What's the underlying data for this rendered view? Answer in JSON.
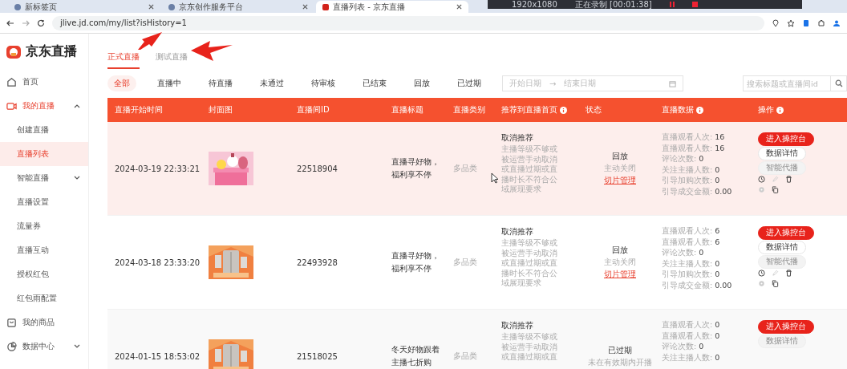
{
  "browser": {
    "tabs": [
      {
        "title": "新标签页",
        "selected": false
      },
      {
        "title": "京东创作服务平台",
        "selected": false
      },
      {
        "title": "直播列表 - 京东直播",
        "selected": true
      }
    ],
    "url": "jlive.jd.com/my/list?isHistory=1"
  },
  "recorder": {
    "resolution": "1920x1080",
    "status": "正在录制 [00:01:38]"
  },
  "logo": "京东直播",
  "sidebar": {
    "items": [
      {
        "label": "首页",
        "selected": false
      },
      {
        "label": "我的直播",
        "selected": true,
        "expanded": true,
        "children": [
          {
            "label": "创建直播",
            "selected": false
          },
          {
            "label": "直播列表",
            "selected": true
          },
          {
            "label": "智能直播",
            "selected": false,
            "expanded": false
          },
          {
            "label": "直播设置",
            "selected": false
          },
          {
            "label": "流量券",
            "selected": false
          },
          {
            "label": "直播互动",
            "selected": false
          },
          {
            "label": "授权红包",
            "selected": false
          },
          {
            "label": "红包雨配置",
            "selected": false
          }
        ]
      },
      {
        "label": "我的商品",
        "selected": false
      },
      {
        "label": "数据中心",
        "selected": false,
        "expanded": false
      }
    ]
  },
  "tabs": [
    {
      "label": "正式直播",
      "selected": true
    },
    {
      "label": "测试直播",
      "selected": false
    }
  ],
  "filters": [
    {
      "label": "全部",
      "selected": true
    },
    {
      "label": "直播中",
      "selected": false
    },
    {
      "label": "待直播",
      "selected": false
    },
    {
      "label": "未通过",
      "selected": false
    },
    {
      "label": "待审核",
      "selected": false
    },
    {
      "label": "已结束",
      "selected": false
    },
    {
      "label": "回放",
      "selected": false
    },
    {
      "label": "已过期",
      "selected": false
    }
  ],
  "date_range": {
    "start_placeholder": "开始日期",
    "separator": "→",
    "end_placeholder": "结束日期"
  },
  "search": {
    "placeholder": "搜索标题或直播间id"
  },
  "table": {
    "columns": [
      {
        "label": "直播开始时间",
        "info": false
      },
      {
        "label": "封面图",
        "info": false
      },
      {
        "label": "直播间ID",
        "info": false
      },
      {
        "label": "直播标题",
        "info": false
      },
      {
        "label": "直播类别",
        "info": false
      },
      {
        "label": "推荐到直播首页",
        "info": true
      },
      {
        "label": "状态",
        "info": false
      },
      {
        "label": "直播数据",
        "info": true
      },
      {
        "label": "操作",
        "info": true
      }
    ],
    "rows": [
      {
        "hovered": true,
        "start_time": "2024-03-19 22:33:21",
        "id": "22518904",
        "title": "直播寻好物，福利享不停",
        "category": "多品类",
        "recommend": {
          "action": "取消推荐",
          "reason": "主播等级不够或被运营手动取消或直播过期或直播时长不符合公域展现要求"
        },
        "status": {
          "kind": "playback",
          "label": "回放",
          "note": "主动关闭",
          "link": "切片管理"
        },
        "stats": [
          {
            "label": "直播观看人次:",
            "value": "16"
          },
          {
            "label": "直播观看人数:",
            "value": "16"
          },
          {
            "label": "评论次数:",
            "value": "0"
          },
          {
            "label": "关注主播人数:",
            "value": "0"
          },
          {
            "label": "引导加购次数:",
            "value": "0"
          },
          {
            "label": "引导成交金额:",
            "value": "0.00"
          }
        ],
        "actions": [
          {
            "label": "进入操控台",
            "kind": "primary",
            "disabled": false
          },
          {
            "label": "数据详情",
            "kind": "plain",
            "disabled": false
          },
          {
            "label": "智能代播",
            "kind": "plain",
            "disabled": true
          }
        ],
        "tools": [
          {
            "disabled": false
          },
          {
            "disabled": true
          },
          {
            "disabled": false
          },
          {
            "disabled": true
          },
          {
            "disabled": false
          }
        ]
      },
      {
        "hovered": false,
        "start_time": "2024-03-18 23:33:20",
        "id": "22493928",
        "title": "直播寻好物，福利享不停",
        "category": "多品类",
        "recommend": {
          "action": "取消推荐",
          "reason": "主播等级不够或被运营手动取消或直播过期或直播时长不符合公域展现要求"
        },
        "status": {
          "kind": "playback",
          "label": "回放",
          "note": "主动关闭",
          "link": "切片管理"
        },
        "stats": [
          {
            "label": "直播观看人次:",
            "value": "6"
          },
          {
            "label": "直播观看人数:",
            "value": "6"
          },
          {
            "label": "评论次数:",
            "value": "0"
          },
          {
            "label": "关注主播人数:",
            "value": "0"
          },
          {
            "label": "引导加购次数:",
            "value": "0"
          },
          {
            "label": "引导成交金额:",
            "value": "0.00"
          }
        ],
        "actions": [
          {
            "label": "进入操控台",
            "kind": "primary",
            "disabled": false
          },
          {
            "label": "数据详情",
            "kind": "plain",
            "disabled": false
          },
          {
            "label": "智能代播",
            "kind": "plain",
            "disabled": true
          }
        ],
        "tools": [
          {
            "disabled": false
          },
          {
            "disabled": true
          },
          {
            "disabled": false
          },
          {
            "disabled": true
          },
          {
            "disabled": false
          }
        ]
      },
      {
        "hovered": false,
        "start_time": "2024-01-15 18:53:02",
        "id": "21518025",
        "title": "冬天好物跟着主播七折购",
        "category": "多品类",
        "recommend": {
          "action": "取消推荐",
          "reason": "主播等级不够或被运营手动取消或直播过期或直"
        },
        "status": {
          "kind": "expired",
          "label": "已过期",
          "note": "未在有效期内开播"
        },
        "stats": [
          {
            "label": "直播观看人次:",
            "value": "0"
          },
          {
            "label": "直播观看人数:",
            "value": "0"
          },
          {
            "label": "评论次数:",
            "value": "0"
          },
          {
            "label": "关注主播人数:",
            "value": "0"
          }
        ],
        "actions": [
          {
            "label": "进入操控台",
            "kind": "primary",
            "disabled": false
          },
          {
            "label": "数据详情",
            "kind": "plain",
            "disabled": true
          }
        ]
      }
    ]
  }
}
